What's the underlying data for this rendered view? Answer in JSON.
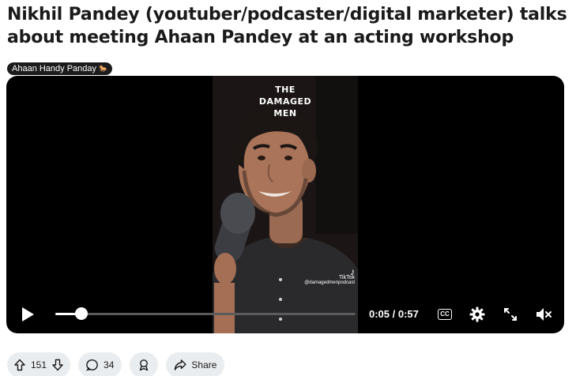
{
  "post": {
    "title": "Nikhil Pandey (youtuber/podcaster/digital marketer) talks about meeting Ahaan Pandey at an acting workshop",
    "flair": "Ahaan Handy Panday",
    "flair_emoji": "🐎"
  },
  "video": {
    "overlay_title_line1": "THE",
    "overlay_title_line2": "DAMAGED",
    "overlay_title_line3": "MEN",
    "watermark_logo": "♪",
    "watermark_name": "TikTok",
    "watermark_handle": "@damagedmenpodcast",
    "time_display": "0:05 / 0:57",
    "progress_fraction": 0.088,
    "cc_label": "CC",
    "icons": {
      "play": "play-icon",
      "cc": "closed-captions-icon",
      "settings": "gear-icon",
      "fullscreen": "expand-icon",
      "mute": "volume-muted-icon"
    }
  },
  "actions": {
    "vote_count": "151",
    "comment_count": "34",
    "share_label": "Share"
  },
  "colors": {
    "pill_bg": "#eaedef",
    "flair_bg": "#1c1c1c",
    "video_bg": "#000000"
  }
}
